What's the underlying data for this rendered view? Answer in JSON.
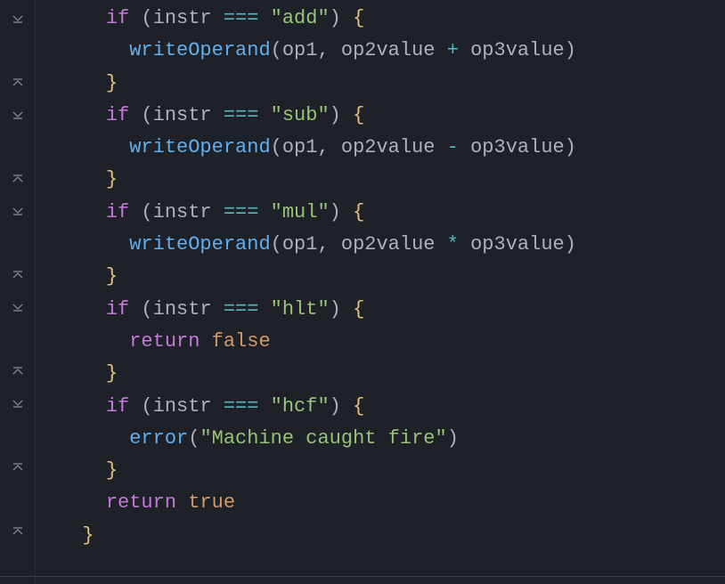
{
  "code": {
    "lines": [
      {
        "indent": 2,
        "tokens": [
          {
            "t": "kw",
            "v": "if"
          },
          {
            "t": "plain",
            "v": " "
          },
          {
            "t": "paren",
            "v": "("
          },
          {
            "t": "ident",
            "v": "instr"
          },
          {
            "t": "plain",
            "v": " "
          },
          {
            "t": "op",
            "v": "==="
          },
          {
            "t": "plain",
            "v": " "
          },
          {
            "t": "str",
            "v": "\"add\""
          },
          {
            "t": "paren",
            "v": ")"
          },
          {
            "t": "plain",
            "v": " "
          },
          {
            "t": "brace",
            "v": "{"
          }
        ]
      },
      {
        "indent": 3,
        "tokens": [
          {
            "t": "fn",
            "v": "writeOperand"
          },
          {
            "t": "paren",
            "v": "("
          },
          {
            "t": "ident",
            "v": "op1"
          },
          {
            "t": "comma",
            "v": ","
          },
          {
            "t": "plain",
            "v": " "
          },
          {
            "t": "ident",
            "v": "op2value"
          },
          {
            "t": "plain",
            "v": " "
          },
          {
            "t": "op",
            "v": "+"
          },
          {
            "t": "plain",
            "v": " "
          },
          {
            "t": "ident",
            "v": "op3value"
          },
          {
            "t": "paren",
            "v": ")"
          }
        ]
      },
      {
        "indent": 2,
        "tokens": [
          {
            "t": "brace",
            "v": "}"
          }
        ]
      },
      {
        "indent": 2,
        "tokens": [
          {
            "t": "kw",
            "v": "if"
          },
          {
            "t": "plain",
            "v": " "
          },
          {
            "t": "paren",
            "v": "("
          },
          {
            "t": "ident",
            "v": "instr"
          },
          {
            "t": "plain",
            "v": " "
          },
          {
            "t": "op",
            "v": "==="
          },
          {
            "t": "plain",
            "v": " "
          },
          {
            "t": "str",
            "v": "\"sub\""
          },
          {
            "t": "paren",
            "v": ")"
          },
          {
            "t": "plain",
            "v": " "
          },
          {
            "t": "brace",
            "v": "{"
          }
        ]
      },
      {
        "indent": 3,
        "tokens": [
          {
            "t": "fn",
            "v": "writeOperand"
          },
          {
            "t": "paren",
            "v": "("
          },
          {
            "t": "ident",
            "v": "op1"
          },
          {
            "t": "comma",
            "v": ","
          },
          {
            "t": "plain",
            "v": " "
          },
          {
            "t": "ident",
            "v": "op2value"
          },
          {
            "t": "plain",
            "v": " "
          },
          {
            "t": "op",
            "v": "-"
          },
          {
            "t": "plain",
            "v": " "
          },
          {
            "t": "ident",
            "v": "op3value"
          },
          {
            "t": "paren",
            "v": ")"
          }
        ]
      },
      {
        "indent": 2,
        "tokens": [
          {
            "t": "brace",
            "v": "}"
          }
        ]
      },
      {
        "indent": 2,
        "tokens": [
          {
            "t": "kw",
            "v": "if"
          },
          {
            "t": "plain",
            "v": " "
          },
          {
            "t": "paren",
            "v": "("
          },
          {
            "t": "ident",
            "v": "instr"
          },
          {
            "t": "plain",
            "v": " "
          },
          {
            "t": "op",
            "v": "==="
          },
          {
            "t": "plain",
            "v": " "
          },
          {
            "t": "str",
            "v": "\"mul\""
          },
          {
            "t": "paren",
            "v": ")"
          },
          {
            "t": "plain",
            "v": " "
          },
          {
            "t": "brace",
            "v": "{"
          }
        ]
      },
      {
        "indent": 3,
        "tokens": [
          {
            "t": "fn",
            "v": "writeOperand"
          },
          {
            "t": "paren",
            "v": "("
          },
          {
            "t": "ident",
            "v": "op1"
          },
          {
            "t": "comma",
            "v": ","
          },
          {
            "t": "plain",
            "v": " "
          },
          {
            "t": "ident",
            "v": "op2value"
          },
          {
            "t": "plain",
            "v": " "
          },
          {
            "t": "op",
            "v": "*"
          },
          {
            "t": "plain",
            "v": " "
          },
          {
            "t": "ident",
            "v": "op3value"
          },
          {
            "t": "paren",
            "v": ")"
          }
        ]
      },
      {
        "indent": 2,
        "tokens": [
          {
            "t": "brace",
            "v": "}"
          }
        ]
      },
      {
        "indent": 2,
        "tokens": [
          {
            "t": "kw",
            "v": "if"
          },
          {
            "t": "plain",
            "v": " "
          },
          {
            "t": "paren",
            "v": "("
          },
          {
            "t": "ident",
            "v": "instr"
          },
          {
            "t": "plain",
            "v": " "
          },
          {
            "t": "op",
            "v": "==="
          },
          {
            "t": "plain",
            "v": " "
          },
          {
            "t": "str",
            "v": "\"hlt\""
          },
          {
            "t": "paren",
            "v": ")"
          },
          {
            "t": "plain",
            "v": " "
          },
          {
            "t": "brace",
            "v": "{"
          }
        ]
      },
      {
        "indent": 3,
        "tokens": [
          {
            "t": "kw",
            "v": "return"
          },
          {
            "t": "plain",
            "v": " "
          },
          {
            "t": "bool",
            "v": "false"
          }
        ]
      },
      {
        "indent": 2,
        "tokens": [
          {
            "t": "brace",
            "v": "}"
          }
        ]
      },
      {
        "indent": 2,
        "tokens": [
          {
            "t": "kw",
            "v": "if"
          },
          {
            "t": "plain",
            "v": " "
          },
          {
            "t": "paren",
            "v": "("
          },
          {
            "t": "ident",
            "v": "instr"
          },
          {
            "t": "plain",
            "v": " "
          },
          {
            "t": "op",
            "v": "==="
          },
          {
            "t": "plain",
            "v": " "
          },
          {
            "t": "str",
            "v": "\"hcf\""
          },
          {
            "t": "paren",
            "v": ")"
          },
          {
            "t": "plain",
            "v": " "
          },
          {
            "t": "brace",
            "v": "{"
          }
        ]
      },
      {
        "indent": 3,
        "tokens": [
          {
            "t": "fn",
            "v": "error"
          },
          {
            "t": "paren",
            "v": "("
          },
          {
            "t": "str",
            "v": "\"Machine caught fire\""
          },
          {
            "t": "paren",
            "v": ")"
          }
        ]
      },
      {
        "indent": 2,
        "tokens": [
          {
            "t": "brace",
            "v": "}"
          }
        ]
      },
      {
        "indent": 2,
        "tokens": [
          {
            "t": "kw",
            "v": "return"
          },
          {
            "t": "plain",
            "v": " "
          },
          {
            "t": "bool",
            "v": "true"
          }
        ]
      },
      {
        "indent": 1,
        "tokens": [
          {
            "t": "brace",
            "v": "}"
          }
        ]
      }
    ],
    "folding": [
      "open",
      "none",
      "close",
      "open",
      "none",
      "close",
      "open",
      "none",
      "close",
      "open",
      "none",
      "close",
      "open",
      "none",
      "close",
      "none",
      "close"
    ]
  }
}
